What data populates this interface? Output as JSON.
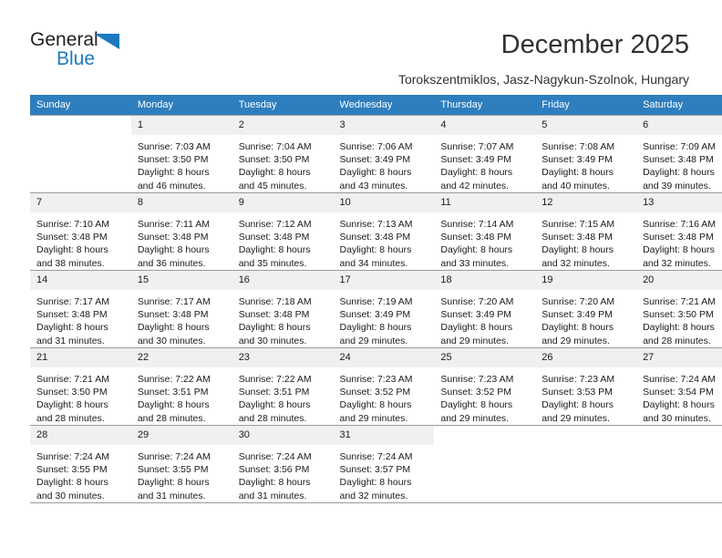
{
  "logo": {
    "word_top": "General",
    "word_bottom": "Blue",
    "triangle_icon": "triangle-icon",
    "brand_color": "#1c79c0",
    "text_color": "#231f20"
  },
  "header": {
    "title": "December 2025",
    "subtitle": "Torokszentmiklos, Jasz-Nagykun-Szolnok, Hungary"
  },
  "calendar": {
    "header_bg": "#2e7ebe",
    "header_text_color": "#ffffff",
    "daynum_bg": "#f0f0f0",
    "weekday_headers": [
      "Sunday",
      "Monday",
      "Tuesday",
      "Wednesday",
      "Thursday",
      "Friday",
      "Saturday"
    ],
    "weeks": [
      [
        {
          "day": "",
          "blank": true,
          "empty": true,
          "sunrise": "",
          "sunset": "",
          "daylight_line1": "",
          "daylight_line2": ""
        },
        {
          "day": "1",
          "sunrise": "Sunrise: 7:03 AM",
          "sunset": "Sunset: 3:50 PM",
          "daylight_line1": "Daylight: 8 hours",
          "daylight_line2": "and 46 minutes."
        },
        {
          "day": "2",
          "sunrise": "Sunrise: 7:04 AM",
          "sunset": "Sunset: 3:50 PM",
          "daylight_line1": "Daylight: 8 hours",
          "daylight_line2": "and 45 minutes."
        },
        {
          "day": "3",
          "sunrise": "Sunrise: 7:06 AM",
          "sunset": "Sunset: 3:49 PM",
          "daylight_line1": "Daylight: 8 hours",
          "daylight_line2": "and 43 minutes."
        },
        {
          "day": "4",
          "sunrise": "Sunrise: 7:07 AM",
          "sunset": "Sunset: 3:49 PM",
          "daylight_line1": "Daylight: 8 hours",
          "daylight_line2": "and 42 minutes."
        },
        {
          "day": "5",
          "sunrise": "Sunrise: 7:08 AM",
          "sunset": "Sunset: 3:49 PM",
          "daylight_line1": "Daylight: 8 hours",
          "daylight_line2": "and 40 minutes."
        },
        {
          "day": "6",
          "sunrise": "Sunrise: 7:09 AM",
          "sunset": "Sunset: 3:48 PM",
          "daylight_line1": "Daylight: 8 hours",
          "daylight_line2": "and 39 minutes."
        }
      ],
      [
        {
          "day": "7",
          "sunrise": "Sunrise: 7:10 AM",
          "sunset": "Sunset: 3:48 PM",
          "daylight_line1": "Daylight: 8 hours",
          "daylight_line2": "and 38 minutes."
        },
        {
          "day": "8",
          "sunrise": "Sunrise: 7:11 AM",
          "sunset": "Sunset: 3:48 PM",
          "daylight_line1": "Daylight: 8 hours",
          "daylight_line2": "and 36 minutes."
        },
        {
          "day": "9",
          "sunrise": "Sunrise: 7:12 AM",
          "sunset": "Sunset: 3:48 PM",
          "daylight_line1": "Daylight: 8 hours",
          "daylight_line2": "and 35 minutes."
        },
        {
          "day": "10",
          "sunrise": "Sunrise: 7:13 AM",
          "sunset": "Sunset: 3:48 PM",
          "daylight_line1": "Daylight: 8 hours",
          "daylight_line2": "and 34 minutes."
        },
        {
          "day": "11",
          "sunrise": "Sunrise: 7:14 AM",
          "sunset": "Sunset: 3:48 PM",
          "daylight_line1": "Daylight: 8 hours",
          "daylight_line2": "and 33 minutes."
        },
        {
          "day": "12",
          "sunrise": "Sunrise: 7:15 AM",
          "sunset": "Sunset: 3:48 PM",
          "daylight_line1": "Daylight: 8 hours",
          "daylight_line2": "and 32 minutes."
        },
        {
          "day": "13",
          "sunrise": "Sunrise: 7:16 AM",
          "sunset": "Sunset: 3:48 PM",
          "daylight_line1": "Daylight: 8 hours",
          "daylight_line2": "and 32 minutes."
        }
      ],
      [
        {
          "day": "14",
          "sunrise": "Sunrise: 7:17 AM",
          "sunset": "Sunset: 3:48 PM",
          "daylight_line1": "Daylight: 8 hours",
          "daylight_line2": "and 31 minutes."
        },
        {
          "day": "15",
          "sunrise": "Sunrise: 7:17 AM",
          "sunset": "Sunset: 3:48 PM",
          "daylight_line1": "Daylight: 8 hours",
          "daylight_line2": "and 30 minutes."
        },
        {
          "day": "16",
          "sunrise": "Sunrise: 7:18 AM",
          "sunset": "Sunset: 3:48 PM",
          "daylight_line1": "Daylight: 8 hours",
          "daylight_line2": "and 30 minutes."
        },
        {
          "day": "17",
          "sunrise": "Sunrise: 7:19 AM",
          "sunset": "Sunset: 3:49 PM",
          "daylight_line1": "Daylight: 8 hours",
          "daylight_line2": "and 29 minutes."
        },
        {
          "day": "18",
          "sunrise": "Sunrise: 7:20 AM",
          "sunset": "Sunset: 3:49 PM",
          "daylight_line1": "Daylight: 8 hours",
          "daylight_line2": "and 29 minutes."
        },
        {
          "day": "19",
          "sunrise": "Sunrise: 7:20 AM",
          "sunset": "Sunset: 3:49 PM",
          "daylight_line1": "Daylight: 8 hours",
          "daylight_line2": "and 29 minutes."
        },
        {
          "day": "20",
          "sunrise": "Sunrise: 7:21 AM",
          "sunset": "Sunset: 3:50 PM",
          "daylight_line1": "Daylight: 8 hours",
          "daylight_line2": "and 28 minutes."
        }
      ],
      [
        {
          "day": "21",
          "sunrise": "Sunrise: 7:21 AM",
          "sunset": "Sunset: 3:50 PM",
          "daylight_line1": "Daylight: 8 hours",
          "daylight_line2": "and 28 minutes."
        },
        {
          "day": "22",
          "sunrise": "Sunrise: 7:22 AM",
          "sunset": "Sunset: 3:51 PM",
          "daylight_line1": "Daylight: 8 hours",
          "daylight_line2": "and 28 minutes."
        },
        {
          "day": "23",
          "sunrise": "Sunrise: 7:22 AM",
          "sunset": "Sunset: 3:51 PM",
          "daylight_line1": "Daylight: 8 hours",
          "daylight_line2": "and 28 minutes."
        },
        {
          "day": "24",
          "sunrise": "Sunrise: 7:23 AM",
          "sunset": "Sunset: 3:52 PM",
          "daylight_line1": "Daylight: 8 hours",
          "daylight_line2": "and 29 minutes."
        },
        {
          "day": "25",
          "sunrise": "Sunrise: 7:23 AM",
          "sunset": "Sunset: 3:52 PM",
          "daylight_line1": "Daylight: 8 hours",
          "daylight_line2": "and 29 minutes."
        },
        {
          "day": "26",
          "sunrise": "Sunrise: 7:23 AM",
          "sunset": "Sunset: 3:53 PM",
          "daylight_line1": "Daylight: 8 hours",
          "daylight_line2": "and 29 minutes."
        },
        {
          "day": "27",
          "sunrise": "Sunrise: 7:24 AM",
          "sunset": "Sunset: 3:54 PM",
          "daylight_line1": "Daylight: 8 hours",
          "daylight_line2": "and 30 minutes."
        }
      ],
      [
        {
          "day": "28",
          "sunrise": "Sunrise: 7:24 AM",
          "sunset": "Sunset: 3:55 PM",
          "daylight_line1": "Daylight: 8 hours",
          "daylight_line2": "and 30 minutes."
        },
        {
          "day": "29",
          "sunrise": "Sunrise: 7:24 AM",
          "sunset": "Sunset: 3:55 PM",
          "daylight_line1": "Daylight: 8 hours",
          "daylight_line2": "and 31 minutes."
        },
        {
          "day": "30",
          "sunrise": "Sunrise: 7:24 AM",
          "sunset": "Sunset: 3:56 PM",
          "daylight_line1": "Daylight: 8 hours",
          "daylight_line2": "and 31 minutes."
        },
        {
          "day": "31",
          "sunrise": "Sunrise: 7:24 AM",
          "sunset": "Sunset: 3:57 PM",
          "daylight_line1": "Daylight: 8 hours",
          "daylight_line2": "and 32 minutes."
        },
        {
          "day": "",
          "blank": true,
          "empty": true,
          "sunrise": "",
          "sunset": "",
          "daylight_line1": "",
          "daylight_line2": ""
        },
        {
          "day": "",
          "blank": true,
          "empty": true,
          "sunrise": "",
          "sunset": "",
          "daylight_line1": "",
          "daylight_line2": ""
        },
        {
          "day": "",
          "blank": true,
          "empty": true,
          "sunrise": "",
          "sunset": "",
          "daylight_line1": "",
          "daylight_line2": ""
        }
      ]
    ]
  }
}
